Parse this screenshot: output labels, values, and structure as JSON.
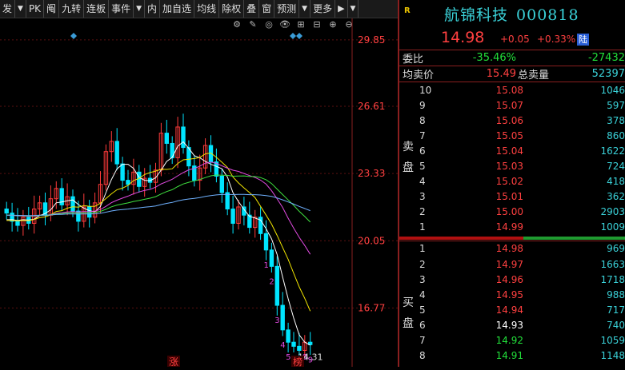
{
  "toolbar": {
    "items": [
      "发",
      "PK",
      "阄",
      "九转",
      "连板",
      "事件",
      "内",
      "加自选",
      "均线",
      "除权",
      "叠",
      "窗",
      "预测",
      "更多"
    ],
    "arrow": "▼",
    "expand": "▶",
    "dropdown_after": [
      0,
      5,
      12
    ]
  },
  "chart_icons": [
    "⚙",
    "✎",
    "◎",
    "👁",
    "⊞",
    "⊟",
    "⊕",
    "⊖"
  ],
  "chart_data": {
    "type": "candlestick",
    "y_ticks": [
      "29.85",
      "26.61",
      "23.33",
      "20.05",
      "16.77"
    ],
    "y_values": [
      29.85,
      26.61,
      23.33,
      20.05,
      16.77
    ],
    "ylim": [
      13.9,
      30.9
    ],
    "low_label": "14.31",
    "bottom_tags": [
      "涨",
      "榜"
    ],
    "up_color": "#ff3b3b",
    "down_color": "#00e5ff",
    "ma_colors": [
      "#ffffff",
      "#f2e600",
      "#e04ae0",
      "#3fe03f",
      "#6fb1ff"
    ],
    "nine_turn_down": [
      "1",
      "2",
      "3",
      "4",
      "5",
      "6",
      "7",
      "8",
      "9"
    ]
  },
  "quote": {
    "r_mark": "R",
    "name": "航锦科技",
    "code": "000818",
    "price": "14.98",
    "change": "+0.05",
    "change_pct": "+0.33%",
    "badge": "陆",
    "ratio_label": "委比",
    "ratio_pct": "-35.46%",
    "ratio_vol": "-27432",
    "avg_label": "均卖价",
    "avg_price": "15.49",
    "total_label": "总卖量",
    "total_vol": "52397",
    "sell_label_1": "卖",
    "sell_label_2": "盘",
    "buy_label_1": "买",
    "buy_label_2": "盘",
    "sell": [
      {
        "n": "10",
        "p": "15.08",
        "v": "1046"
      },
      {
        "n": "9",
        "p": "15.07",
        "v": "597"
      },
      {
        "n": "8",
        "p": "15.06",
        "v": "378"
      },
      {
        "n": "7",
        "p": "15.05",
        "v": "860"
      },
      {
        "n": "6",
        "p": "15.04",
        "v": "1622"
      },
      {
        "n": "5",
        "p": "15.03",
        "v": "724"
      },
      {
        "n": "4",
        "p": "15.02",
        "v": "418"
      },
      {
        "n": "3",
        "p": "15.01",
        "v": "362"
      },
      {
        "n": "2",
        "p": "15.00",
        "v": "2903"
      },
      {
        "n": "1",
        "p": "14.99",
        "v": "1009"
      }
    ],
    "buy": [
      {
        "n": "1",
        "p": "14.98",
        "v": "969",
        "c": "#ff4040"
      },
      {
        "n": "2",
        "p": "14.97",
        "v": "1663",
        "c": "#ff4040"
      },
      {
        "n": "3",
        "p": "14.96",
        "v": "1718",
        "c": "#ff4040"
      },
      {
        "n": "4",
        "p": "14.95",
        "v": "988",
        "c": "#ff4040"
      },
      {
        "n": "5",
        "p": "14.94",
        "v": "717",
        "c": "#ff4040"
      },
      {
        "n": "6",
        "p": "14.93",
        "v": "740",
        "c": "#ffffff"
      },
      {
        "n": "7",
        "p": "14.92",
        "v": "1059",
        "c": "#22e03a"
      },
      {
        "n": "8",
        "p": "14.91",
        "v": "1148",
        "c": "#22e03a"
      }
    ]
  }
}
